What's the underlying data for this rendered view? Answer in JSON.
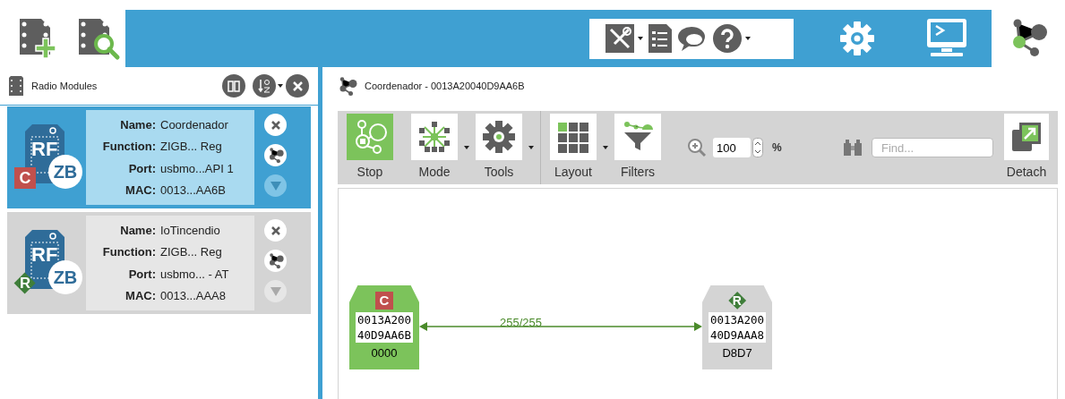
{
  "top_left_buttons": [
    {
      "kind": "add"
    },
    {
      "kind": "discover"
    }
  ],
  "top_tools": [
    {
      "kind": "tools",
      "dropdown": true
    },
    {
      "kind": "frames",
      "dropdown": false
    },
    {
      "kind": "feedback",
      "dropdown": false
    },
    {
      "kind": "help",
      "dropdown": true
    }
  ],
  "modes": [
    {
      "kind": "configuration",
      "selected": false
    },
    {
      "kind": "console",
      "selected": false
    },
    {
      "kind": "network",
      "selected": true
    }
  ],
  "sidebar": {
    "title": "Radio Modules",
    "modules": [
      {
        "kind": "coordinator",
        "chip_label": "RF",
        "badge": "C",
        "protocol": "ZB",
        "selected": true,
        "fields": [
          {
            "label": "Name:",
            "value": "Coordenador"
          },
          {
            "label": "Function:",
            "value": "ZIGB... Reg"
          },
          {
            "label": "Port:",
            "value": "usbmo...API 1"
          },
          {
            "label": "MAC:",
            "value": "0013...AA6B"
          }
        ]
      },
      {
        "kind": "router",
        "chip_label": "RF",
        "badge": "R",
        "protocol": "ZB",
        "selected": false,
        "fields": [
          {
            "label": "Name:",
            "value": "IoTincendio"
          },
          {
            "label": "Function:",
            "value": "ZIGB... Reg"
          },
          {
            "label": "Port:",
            "value": "usbmo... - AT"
          },
          {
            "label": "MAC:",
            "value": "0013...AAA8"
          }
        ]
      }
    ]
  },
  "network": {
    "title": "Coordenador - 0013A20040D9AA6B",
    "toolbar": [
      {
        "kind": "stop",
        "label": "Stop",
        "selected": true,
        "dropdown": false
      },
      {
        "kind": "mode",
        "label": "Mode",
        "selected": false,
        "dropdown": true
      },
      {
        "kind": "tools",
        "label": "Tools",
        "selected": false,
        "dropdown": true
      },
      {
        "kind": "layout",
        "label": "Layout",
        "selected": false,
        "dropdown": true
      },
      {
        "kind": "filters",
        "label": "Filters",
        "selected": false,
        "dropdown": false
      }
    ],
    "zoom": {
      "value": "100",
      "unit": "%"
    },
    "search": {
      "placeholder": "Find..."
    },
    "detach": {
      "label": "Detach"
    },
    "nodes": [
      {
        "kind": "coordinator",
        "badge": "C",
        "address": [
          "0013A200",
          "40D9AA6B"
        ],
        "short_address": "0000"
      },
      {
        "kind": "router",
        "badge": "R",
        "address": [
          "0013A200",
          "40D9AAA8"
        ],
        "short_address": "D8D7"
      }
    ],
    "links": [
      {
        "label": "255/255"
      }
    ]
  }
}
